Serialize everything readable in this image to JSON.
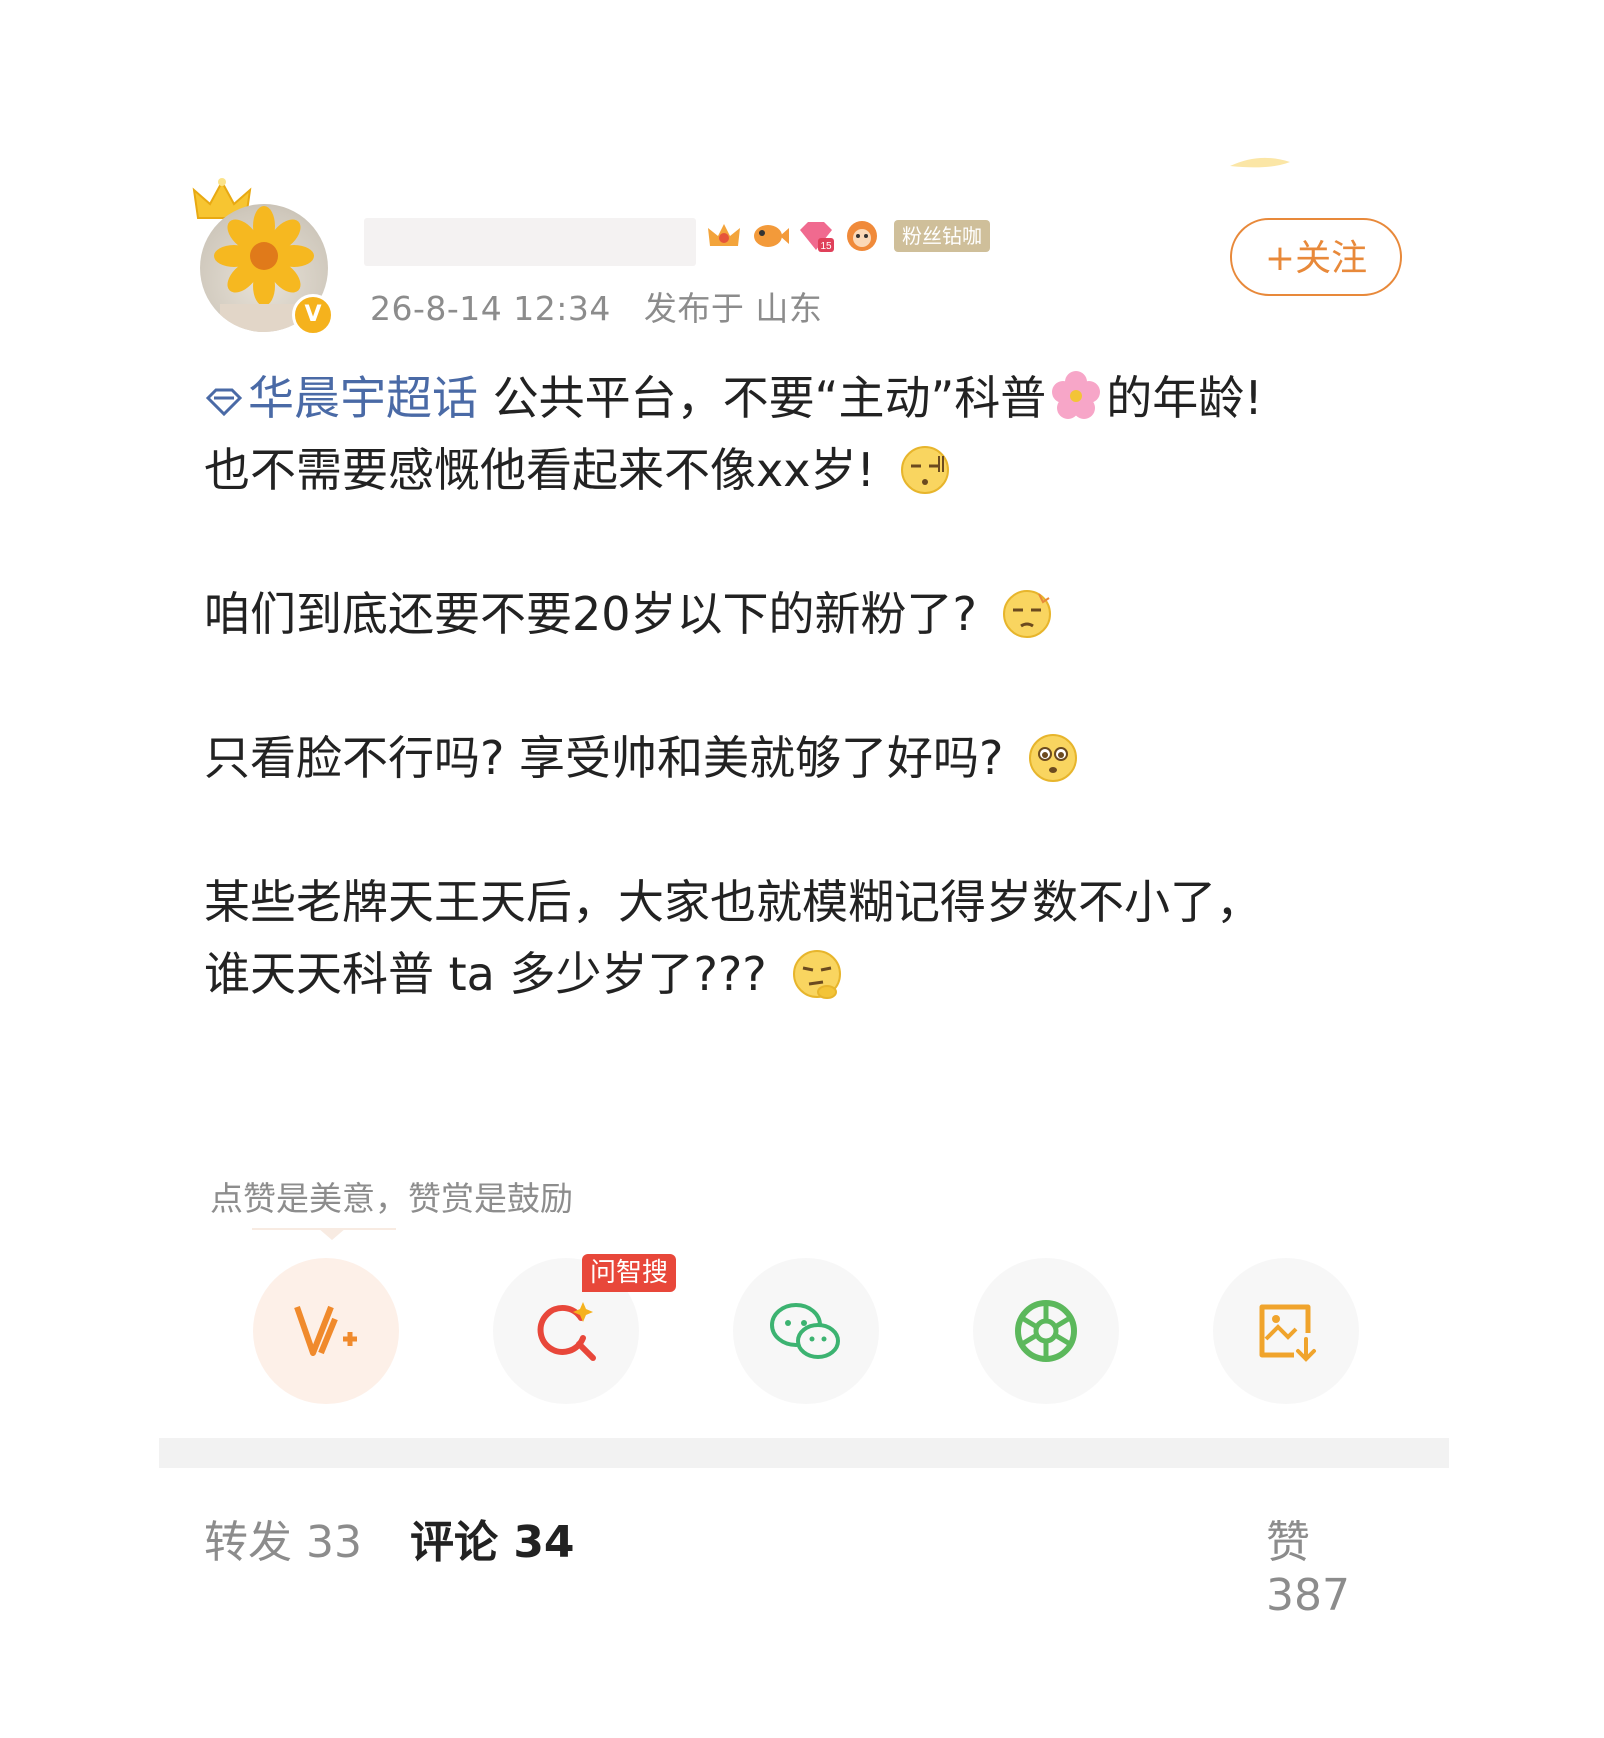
{
  "post": {
    "timestamp": "26-8-14 12:34",
    "location": "发布于 山东",
    "fan_badge": "粉丝钻咖",
    "follow_label": "+关注",
    "topic": "华晨宇超话",
    "line1_after_topic": " 公共平台，不要“主动”科普",
    "line1_tail": "的年龄!",
    "line2": "也不需要感慨他看起来不像xx岁!",
    "line3": "咱们到底还要不要20岁以下的新粉了?",
    "line4": "只看脸不行吗? 享受帅和美就够了好吗?",
    "line5": "某些老牌天王天后，大家也就模糊记得岁数不小了，",
    "line6": "谁天天科普 ta 多少岁了???",
    "hint": "点赞是美意，赞赏是鼓励",
    "zhisou_tag": "问智搜"
  },
  "icons": {
    "crown": "crown-icon",
    "verify": "verified-v-icon",
    "topic": "diamond-topic-icon",
    "emoji_flower": "cherry-blossom-emoji",
    "emoji1": "sweat-emoji",
    "emoji2": "dizzy-emoji",
    "emoji3": "pleading-emoji",
    "emoji4": "thinking-emoji"
  },
  "tabs": {
    "repost": "转发 33",
    "comment": "评论 34",
    "like": "赞 387"
  },
  "colors": {
    "accent": "#e8893a",
    "topic": "#4a6aa6",
    "tag_red": "#e8473a"
  }
}
